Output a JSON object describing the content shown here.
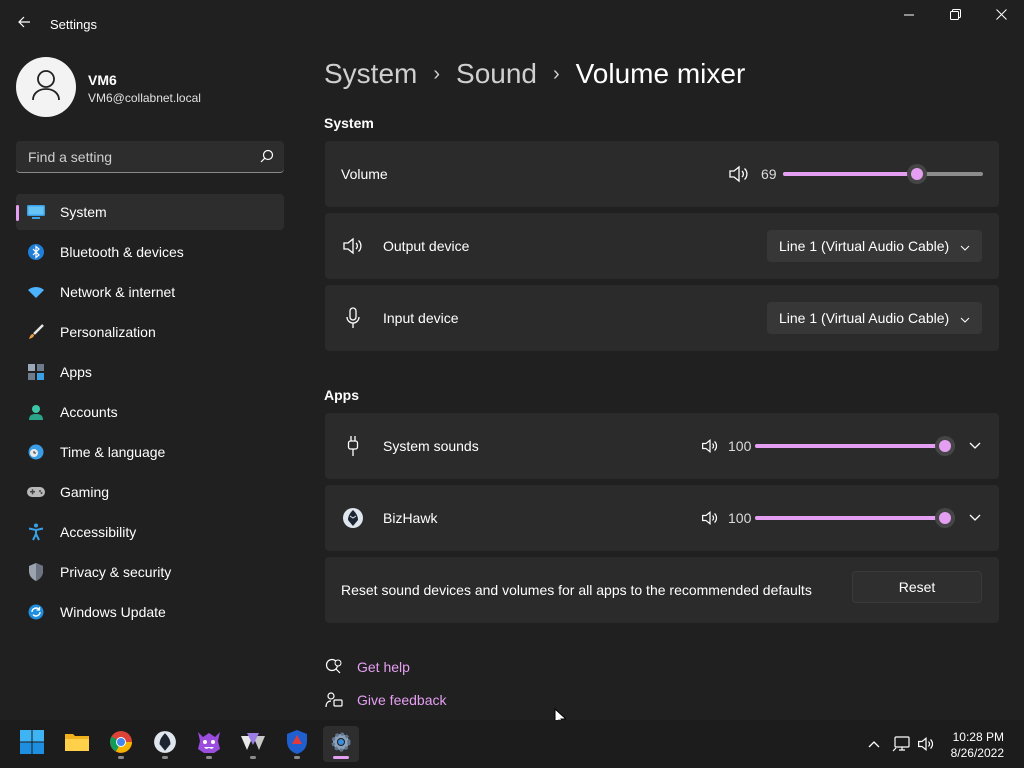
{
  "window": {
    "title": "Settings",
    "controls": [
      "minimize",
      "maximize",
      "close"
    ]
  },
  "profile": {
    "name": "VM6",
    "email": "VM6@collabnet.local"
  },
  "search": {
    "placeholder": "Find a setting"
  },
  "sidebar": {
    "items": [
      {
        "label": "System",
        "icon": "monitor-icon",
        "selected": true
      },
      {
        "label": "Bluetooth & devices",
        "icon": "bluetooth-icon"
      },
      {
        "label": "Network & internet",
        "icon": "wifi-icon"
      },
      {
        "label": "Personalization",
        "icon": "brush-icon"
      },
      {
        "label": "Apps",
        "icon": "apps-icon"
      },
      {
        "label": "Accounts",
        "icon": "person-icon"
      },
      {
        "label": "Time & language",
        "icon": "clock-globe-icon"
      },
      {
        "label": "Gaming",
        "icon": "gamepad-icon"
      },
      {
        "label": "Accessibility",
        "icon": "accessibility-icon"
      },
      {
        "label": "Privacy & security",
        "icon": "shield-icon"
      },
      {
        "label": "Windows Update",
        "icon": "update-icon"
      }
    ]
  },
  "breadcrumb": {
    "items": [
      "System",
      "Sound",
      "Volume mixer"
    ]
  },
  "system_section": {
    "heading": "System",
    "volume": {
      "label": "Volume",
      "value": "69",
      "level": 0.69
    },
    "output": {
      "label": "Output device",
      "selected": "Line 1 (Virtual Audio Cable)"
    },
    "input": {
      "label": "Input device",
      "selected": "Line 1 (Virtual Audio Cable)"
    }
  },
  "apps_section": {
    "heading": "Apps",
    "apps": [
      {
        "name": "System sounds",
        "value": "100",
        "level": 1.0
      },
      {
        "name": "BizHawk",
        "value": "100",
        "level": 1.0
      }
    ],
    "reset": {
      "text": "Reset sound devices and volumes for all apps to the recommended defaults",
      "button": "Reset"
    }
  },
  "links": {
    "help": "Get help",
    "feedback": "Give feedback"
  },
  "taskbar": {
    "apps": [
      "windows-start",
      "file-explorer",
      "chrome",
      "bizhawk",
      "game",
      "app",
      "shield-app",
      "settings"
    ],
    "clock": {
      "time": "10:28 PM",
      "date": "8/26/2022"
    }
  },
  "colors": {
    "accent": "#e59ff2",
    "background": "#202020",
    "card": "#2b2b2b"
  }
}
